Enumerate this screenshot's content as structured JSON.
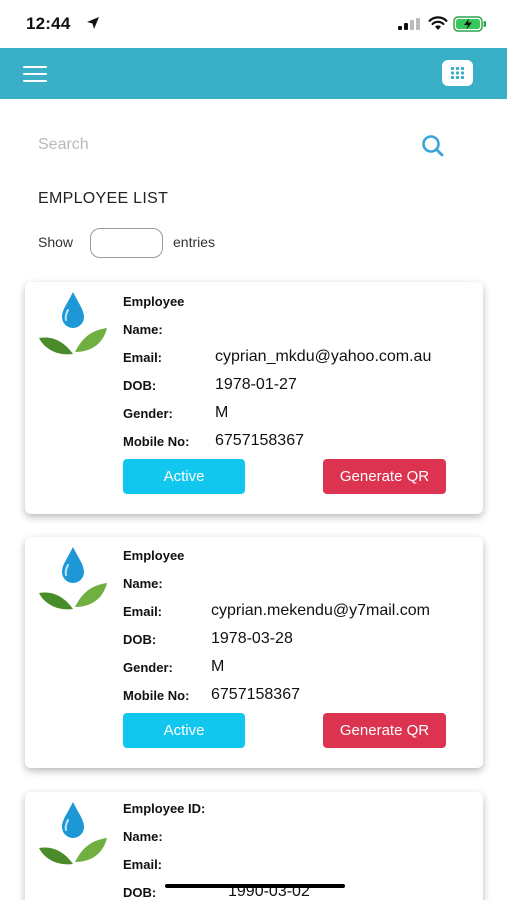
{
  "status_bar": {
    "time": "12:44"
  },
  "header": {
    "menu_icon": "hamburger-menu-icon",
    "grid_icon": "grid-icon",
    "accent_color": "#3ab0c8"
  },
  "search": {
    "placeholder": "Search",
    "value": ""
  },
  "list": {
    "title": "EMPLOYEE LIST",
    "show_label": "Show",
    "entries_label": "entries",
    "entries_value": ""
  },
  "colors": {
    "active_button": "#12c7ee",
    "qr_button": "#dc3350"
  },
  "cards": [
    {
      "header_label": "Employee",
      "name_label": "Name:",
      "email_label": "Email:",
      "email": "cyprian_mkdu@yahoo.com.au",
      "dob_label": "DOB:",
      "dob": "1978-01-27",
      "gender_label": "Gender:",
      "gender": "M",
      "mobile_label": "Mobile No:",
      "mobile": "6757158367",
      "active_label": "Active",
      "qr_label": "Generate QR"
    },
    {
      "header_label": "Employee",
      "name_label": "Name:",
      "email_label": "Email:",
      "email": "cyprian.mekendu@y7mail.com",
      "dob_label": "DOB:",
      "dob": "1978-03-28",
      "gender_label": "Gender:",
      "gender": "M",
      "mobile_label": "Mobile No:",
      "mobile": "6757158367",
      "active_label": "Active",
      "qr_label": "Generate QR"
    },
    {
      "header_label": "Employee ID:",
      "name_label": "Name:",
      "email_label": "Email:",
      "dob_label": "DOB:",
      "dob": "1990-03-02"
    }
  ]
}
